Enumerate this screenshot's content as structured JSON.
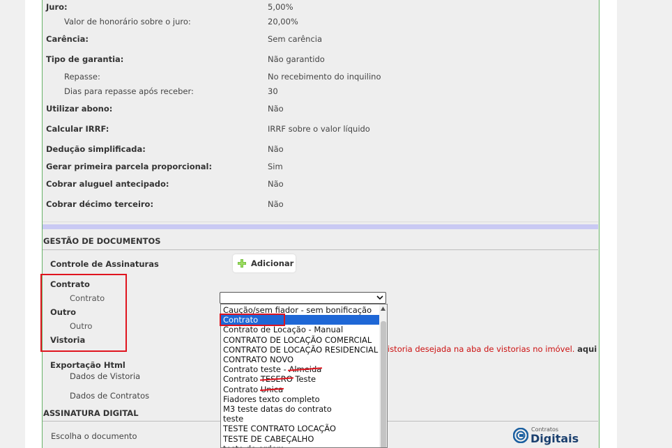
{
  "summary": {
    "juro_label": "Juro:",
    "juro_value": "5,00%",
    "honorario_label": "Valor de honorário sobre o juro:",
    "honorario_value": "20,00%",
    "carencia_label": "Carência:",
    "carencia_value": "Sem carência",
    "garantia_label": "Tipo de garantia:",
    "garantia_value": "Não garantido",
    "repasse_label": "Repasse:",
    "repasse_value": "No recebimento do inquilino",
    "dias_label": "Dias para repasse após receber:",
    "dias_value": "30",
    "abono_label": "Utilizar abono:",
    "abono_value": "Não",
    "irrf_label": "Calcular IRRF:",
    "irrf_value": "IRRF sobre o valor líquido",
    "deducao_label": "Dedução simplificada:",
    "deducao_value": "Não",
    "parcela_label": "Gerar primeira parcela proporcional:",
    "parcela_value": "Sim",
    "aluguel_label": "Cobrar aluguel antecipado:",
    "aluguel_value": "Não",
    "decimo_label": "Cobrar décimo terceiro:",
    "decimo_value": "Não"
  },
  "gestao": {
    "title": "GESTÃO DE DOCUMENTOS",
    "controle_label": "Controle de Assinaturas",
    "add_label": "Adicionar",
    "contrato_label": "Contrato",
    "contrato_sub": "Contrato",
    "outro_label": "Outro",
    "outro_sub": "Outro",
    "vistoria_label": "Vistoria",
    "vistoria_msg": "istoria desejada na aba de vistorias no imóvel.",
    "vistoria_link": "aqui",
    "exportacao_label": "Exportação Html",
    "dados_vistoria": "Dados de Vistoria",
    "dados_contratos": "Dados de Contratos"
  },
  "assinatura": {
    "title": "ASSINATURA DIGITAL",
    "escolha_label": "Escolha o documento"
  },
  "dropdown": {
    "options": [
      {
        "text": "Caução/sem fiador - sem bonificação"
      },
      {
        "text": "Contrato",
        "selected": true
      },
      {
        "text": "Contrato de Locação - Manual"
      },
      {
        "text": "CONTRATO DE LOCAÇÃO COMERCIAL"
      },
      {
        "text": "CONTRATO DE LOCAÇÃO RESIDENCIAL"
      },
      {
        "text": "CONTRATO NOVO"
      },
      {
        "text": "Contrato teste - ",
        "struck": "Almeida"
      },
      {
        "text": "Contrato ",
        "struck": "TESERO",
        "after": " Teste"
      },
      {
        "text": "Contrato ",
        "struck": "Unica"
      },
      {
        "text": "Fiadores texto completo"
      },
      {
        "text": "M3 teste datas do contrato"
      },
      {
        "text": "teste"
      },
      {
        "text": "TESTE CONTRATO LOCAÇÃO"
      },
      {
        "text": "TESTE DE CABEÇALHO"
      },
      {
        "text": "teste de ordem"
      }
    ]
  },
  "logo": {
    "small": "Contratos",
    "big": "Digitais"
  },
  "colors": {
    "highlight_red": "#e0141e",
    "selected_blue": "#1e67d6",
    "panel_border": "#66b266",
    "lavender_bar": "#c9c9f3"
  }
}
